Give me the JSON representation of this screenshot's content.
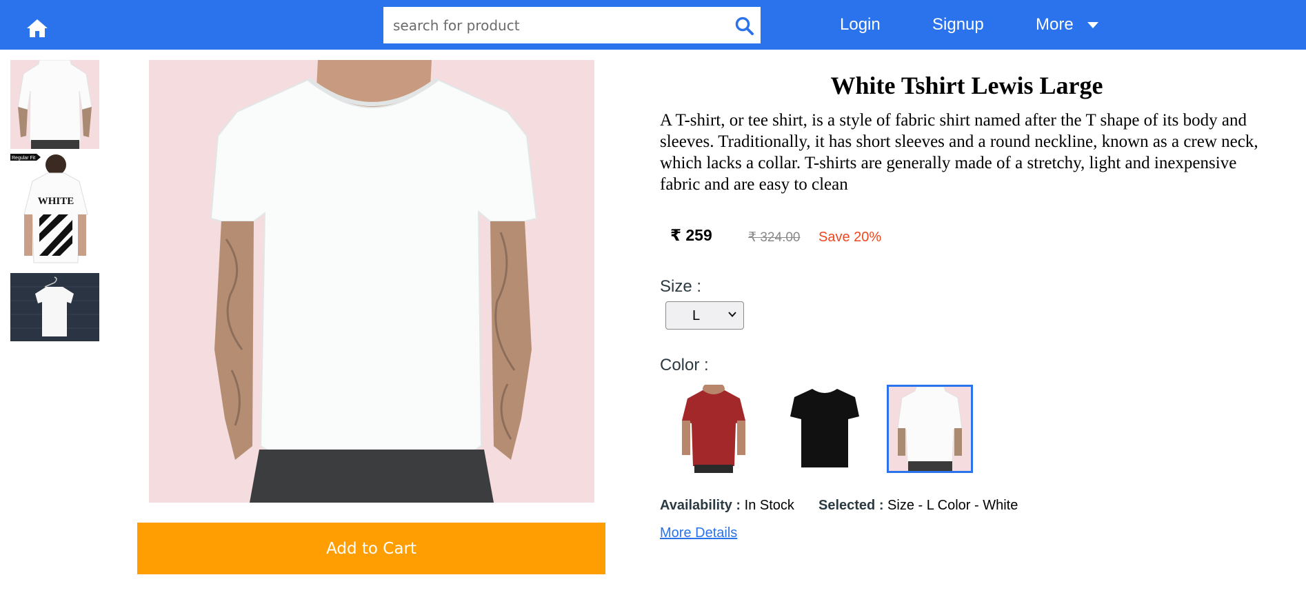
{
  "header": {
    "search": {
      "placeholder": "search for product",
      "value": ""
    },
    "nav": {
      "login": "Login",
      "signup": "Signup",
      "more": "More"
    },
    "icons": {
      "home": "home-icon",
      "search": "search-icon",
      "more": "caret-down-icon"
    },
    "colors": {
      "bar": "#2b73ec"
    }
  },
  "gallery": {
    "thumbnails": [
      {
        "name": "front-view"
      },
      {
        "name": "back-view",
        "badge": "Regular Fit",
        "print": "WHITE"
      },
      {
        "name": "hanger-view"
      }
    ]
  },
  "cart": {
    "label": "Add to Cart",
    "color": "#fe9e02"
  },
  "product": {
    "title": "White Tshirt Lewis Large",
    "description": "A T-shirt, or tee shirt, is a style of fabric shirt named after the T shape of its body and sleeves. Traditionally, it has short sleeves and a round neckline, known as a crew neck, which lacks a collar. T-shirts are generally made of a stretchy, light and inexpensive fabric and are easy to clean",
    "price": "₹ 259",
    "mrp": "₹ 324.00",
    "save": "Save 20%",
    "size_label": "Size :",
    "size_value": "L",
    "color_label": "Color :",
    "colors": [
      {
        "name": "Red",
        "hex": "#a3282a"
      },
      {
        "name": "Black",
        "hex": "#111111"
      },
      {
        "name": "White",
        "hex": "#f5f5f5",
        "selected": true
      }
    ],
    "availability_label": "Availability :",
    "availability_value": "In Stock",
    "selected_label": "Selected :",
    "selected_value": "Size - L Color - White",
    "more_details": "More Details"
  }
}
